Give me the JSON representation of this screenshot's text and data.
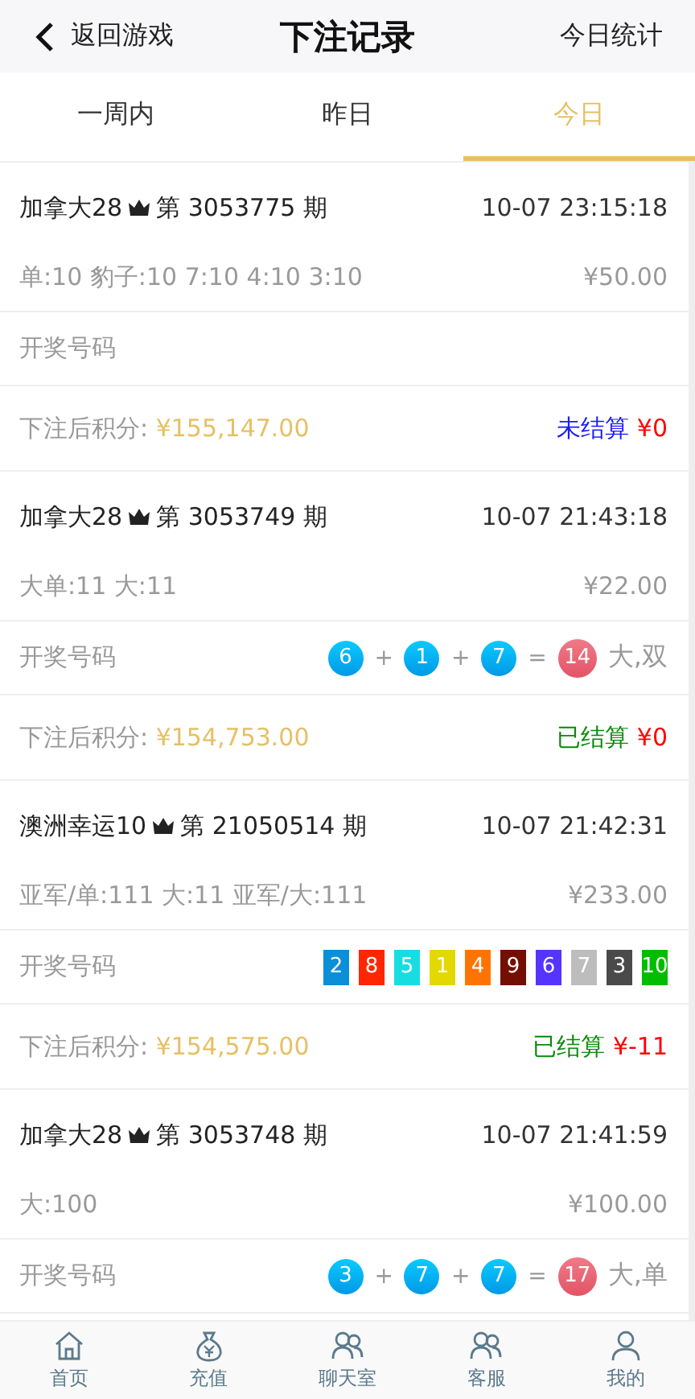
{
  "header": {
    "back": "返回游戏",
    "title": "下注记录",
    "action": "今日统计"
  },
  "tabs": [
    {
      "label": "一周内",
      "selected": false
    },
    {
      "label": "昨日",
      "selected": false
    },
    {
      "label": "今日",
      "selected": true
    }
  ],
  "records": [
    {
      "game": "加拿大28",
      "period": "第 3053775 期",
      "time": "10-07 23:15:18",
      "bet": "单:10 豹子:10 7:10 4:10 3:10",
      "amount": "¥50.00",
      "draw_label": "开奖号码",
      "balance_label": "下注后积分:",
      "balance": "¥155,147.00",
      "status": "未结算",
      "settled": false,
      "win": "¥0"
    },
    {
      "game": "加拿大28",
      "period": "第 3053749 期",
      "time": "10-07 21:43:18",
      "bet": "大单:11 大:11",
      "amount": "¥22.00",
      "draw_label": "开奖号码",
      "draw": [
        {
          "kind": "ball",
          "text": "6"
        },
        {
          "kind": "op",
          "text": "+"
        },
        {
          "kind": "ball",
          "text": "1"
        },
        {
          "kind": "op",
          "text": "+"
        },
        {
          "kind": "ball",
          "text": "7"
        },
        {
          "kind": "op",
          "text": "="
        },
        {
          "kind": "total",
          "text": "14"
        },
        {
          "kind": "result",
          "text": "大,双"
        }
      ],
      "balance_label": "下注后积分:",
      "balance": "¥154,753.00",
      "status": "已结算",
      "settled": true,
      "win": "¥0"
    },
    {
      "game": "澳洲幸运10",
      "period": "第 21050514 期",
      "time": "10-07 21:42:31",
      "bet": "亚军/单:111 大:11 亚军/大:111",
      "amount": "¥233.00",
      "draw_label": "开奖号码",
      "draw": [
        {
          "kind": "square",
          "text": "2",
          "color": "#0a8fd8"
        },
        {
          "kind": "square",
          "text": "8",
          "color": "#ff2600"
        },
        {
          "kind": "square",
          "text": "5",
          "color": "#17dde3"
        },
        {
          "kind": "square",
          "text": "1",
          "color": "#e3d800"
        },
        {
          "kind": "square",
          "text": "4",
          "color": "#ff7300"
        },
        {
          "kind": "square",
          "text": "9",
          "color": "#730e00"
        },
        {
          "kind": "square",
          "text": "6",
          "color": "#5634ff"
        },
        {
          "kind": "square",
          "text": "7",
          "color": "#bdbdbd"
        },
        {
          "kind": "square",
          "text": "3",
          "color": "#4a4a4a"
        },
        {
          "kind": "square",
          "text": "10",
          "color": "#00bd00"
        }
      ],
      "balance_label": "下注后积分:",
      "balance": "¥154,575.00",
      "status": "已结算",
      "settled": true,
      "win": "¥-11"
    },
    {
      "game": "加拿大28",
      "period": "第 3053748 期",
      "time": "10-07 21:41:59",
      "bet": "大:100",
      "amount": "¥100.00",
      "draw_label": "开奖号码",
      "draw": [
        {
          "kind": "ball",
          "text": "3"
        },
        {
          "kind": "op",
          "text": "+"
        },
        {
          "kind": "ball",
          "text": "7"
        },
        {
          "kind": "op",
          "text": "+"
        },
        {
          "kind": "ball",
          "text": "7"
        },
        {
          "kind": "op",
          "text": "="
        },
        {
          "kind": "total",
          "text": "17"
        },
        {
          "kind": "result",
          "text": "大,单"
        }
      ]
    }
  ],
  "nav": [
    {
      "kind": "home",
      "label": "首页"
    },
    {
      "kind": "money",
      "label": "充值"
    },
    {
      "kind": "chat",
      "label": "聊天室"
    },
    {
      "kind": "service",
      "label": "客服"
    },
    {
      "kind": "user",
      "label": "我的"
    }
  ]
}
